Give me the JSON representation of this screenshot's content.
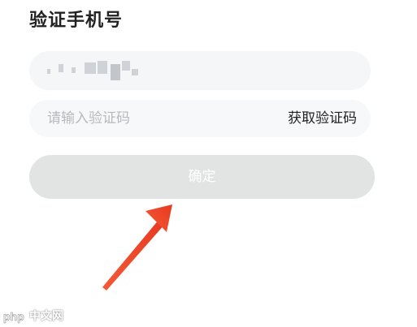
{
  "page": {
    "title": "验证手机号"
  },
  "phone": {
    "masked": true,
    "mask_color": "#cfd2d6"
  },
  "code": {
    "placeholder": "请输入验证码",
    "value": "",
    "get_code_label": "获取验证码"
  },
  "confirm": {
    "label": "确定",
    "bg_color": "#e2e4e4"
  },
  "annotation": {
    "arrow_color": "#f04a2b"
  },
  "watermark": {
    "logo_text": "php",
    "text": "中文网"
  }
}
